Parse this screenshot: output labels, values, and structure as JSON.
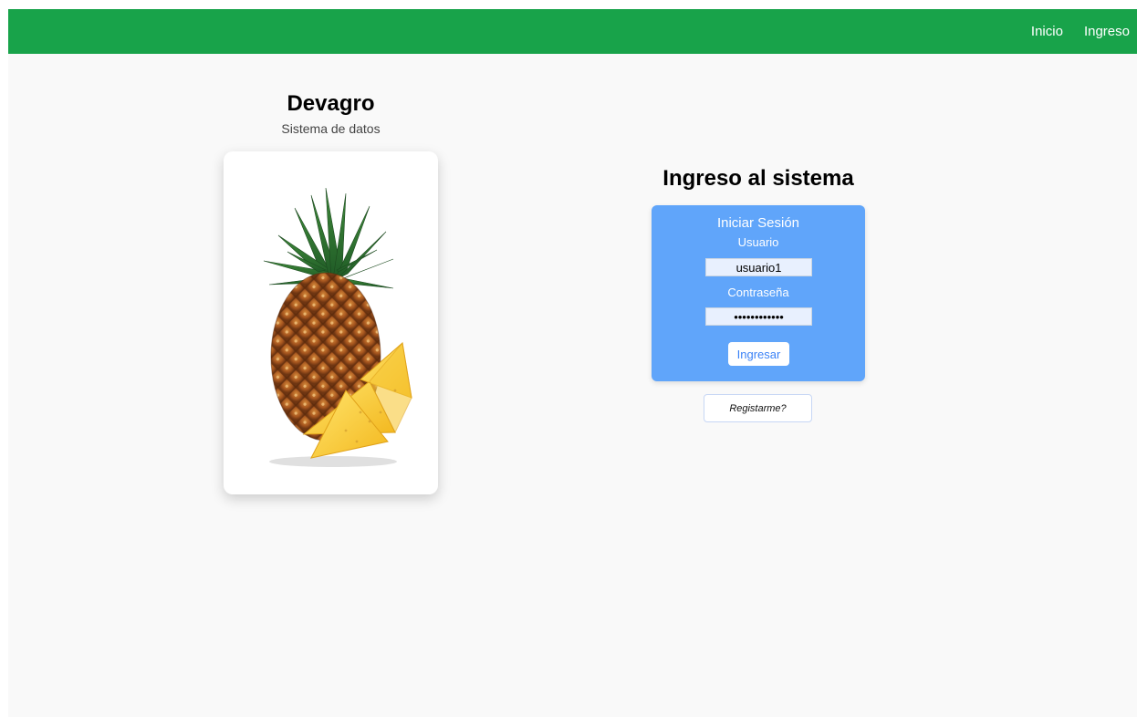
{
  "nav": {
    "links": [
      {
        "label": "Inicio"
      },
      {
        "label": "Ingreso"
      }
    ]
  },
  "brand": {
    "title": "Devagro",
    "subtitle": "Sistema de datos"
  },
  "image_card": {
    "icon": "pineapple-image"
  },
  "login": {
    "title": "Ingreso al sistema",
    "card_heading": "Iniciar Sesión",
    "username_label": "Usuario",
    "username_value": "usuario1",
    "password_label": "Contraseña",
    "password_value": "••••••••••••",
    "submit_label": "Ingresar",
    "register_label": "Registarme?"
  },
  "colors": {
    "navbar": "#18a34a",
    "login_card": "#60a5fa",
    "page_background": "#f9f9f9"
  }
}
